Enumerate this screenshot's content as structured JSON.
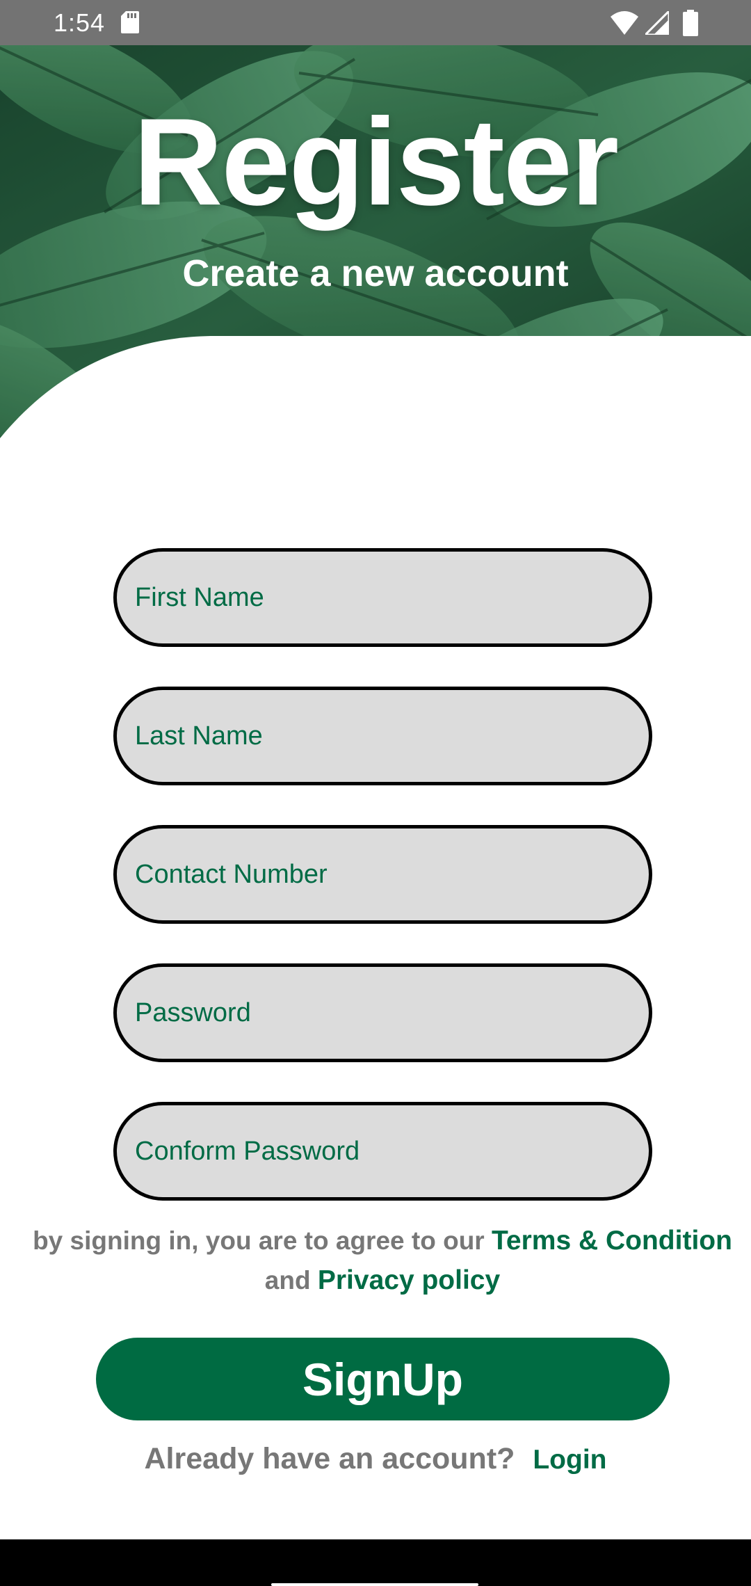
{
  "status_bar": {
    "time": "1:54"
  },
  "header": {
    "title": "Register",
    "subtitle": "Create a new account"
  },
  "form": {
    "fields": [
      {
        "placeholder": "First Name",
        "value": ""
      },
      {
        "placeholder": "Last Name",
        "value": ""
      },
      {
        "placeholder": "Contact Number",
        "value": ""
      },
      {
        "placeholder": "Password",
        "value": ""
      },
      {
        "placeholder": "Conform Password",
        "value": ""
      }
    ]
  },
  "terms": {
    "prefix": "by signing in, you are to agree to our",
    "terms_link": "Terms & Condition",
    "conjunction": "and",
    "privacy_link": "Privacy policy"
  },
  "actions": {
    "signup_label": "SignUp",
    "login_prompt": "Already have an account?",
    "login_link": "Login"
  },
  "colors": {
    "primary_green": "#006b45",
    "field_background": "#dcdcdc",
    "muted_text": "#777777",
    "status_bar": "#737373"
  }
}
